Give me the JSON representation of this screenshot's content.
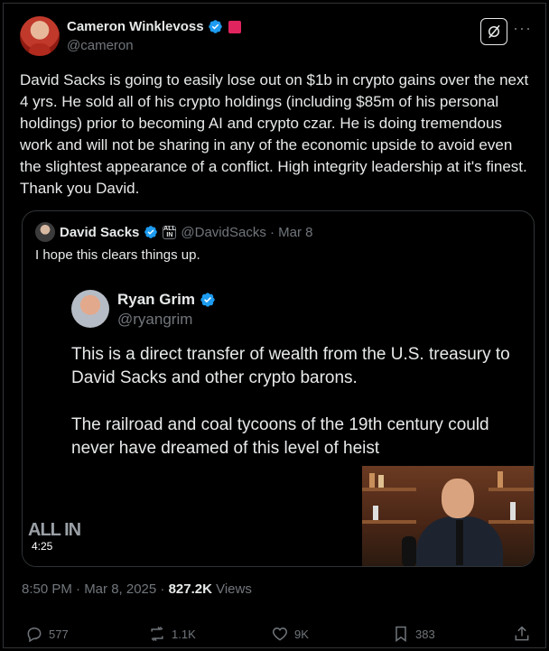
{
  "author": {
    "name": "Cameron Winklevoss",
    "handle": "@cameron"
  },
  "post_text": "David Sacks is going to easily lose out on $1b in crypto gains over the next 4 yrs. He sold all of his crypto holdings (including $85m of his personal holdings) prior to becoming AI and crypto czar. He is doing tremendous work and will not be sharing in any of the economic upside to avoid even the slightest appearance of a conflict. High integrity leadership at it's finest. Thank you David.",
  "quoted": {
    "name": "David Sacks",
    "badge": "ALL IN",
    "handle_date": "@DavidSacks · Mar 8",
    "text": "I hope this clears things up.",
    "media": {
      "inner_name": "Ryan Grim",
      "inner_handle": "@ryangrim",
      "inner_p1": "This is a direct transfer of wealth from the U.S. treasury to David Sacks and other crypto barons.",
      "inner_p2": "The railroad and coal tycoons of the 19th century could never have dreamed of this level of heist",
      "logo": "ALL IN",
      "duration": "4:25"
    }
  },
  "meta": {
    "time_date": "8:50 PM · Mar 8, 2025 · ",
    "views_count": "827.2K",
    "views_label": " Views"
  },
  "actions": {
    "replies": "577",
    "reposts": "1.1K",
    "likes": "9K",
    "bookmarks": "383"
  },
  "colors": {
    "background": "#000000",
    "text": "#e7e9ea",
    "muted": "#71767b",
    "verified": "#1d9bf0",
    "border": "#2f3336",
    "pink_badge": "#e0245e"
  }
}
